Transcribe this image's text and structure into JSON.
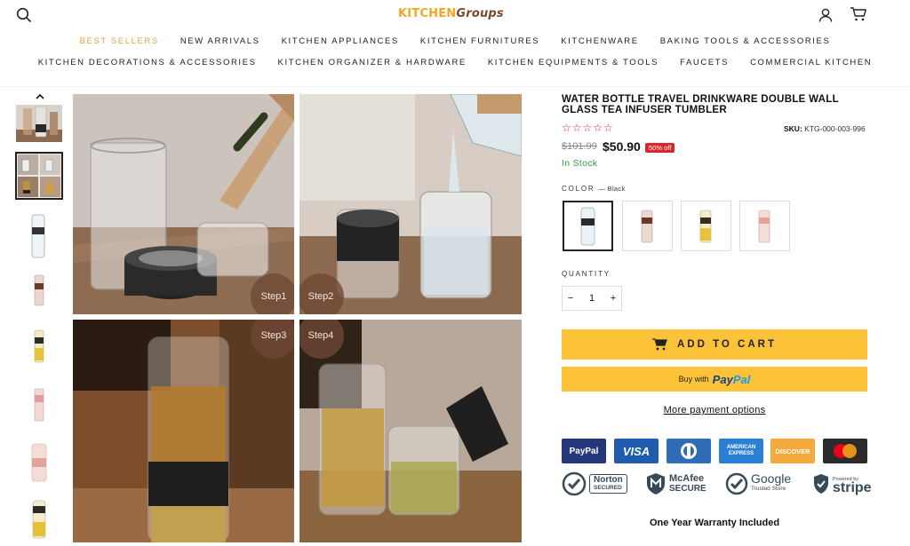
{
  "header": {
    "logo_part1": "KITCHEN",
    "logo_part2": "Groups",
    "icons": [
      "search-icon",
      "account-icon",
      "cart-icon"
    ]
  },
  "nav": {
    "row1": [
      "BEST SELLERS",
      "NEW ARRIVALS",
      "KITCHEN APPLIANCES",
      "KITCHEN FURNITURES",
      "KITCHENWARE",
      "BAKING TOOLS & ACCESSORIES"
    ],
    "row2": [
      "KITCHEN DECORATIONS & ACCESSORIES",
      "KITCHEN ORGANIZER & HARDWARE",
      "KITCHEN EQUIPMENTS & TOOLS",
      "FAUCETS",
      "COMMERCIAL KITCHEN"
    ],
    "active_color": "#e0a43c"
  },
  "gallery": {
    "steps": [
      "Step1",
      "Step2",
      "Step3",
      "Step4"
    ],
    "selected_thumb_index": 1
  },
  "product": {
    "title": "WATER BOTTLE TRAVEL DRINKWARE DOUBLE WALL GLASS TEA INFUSER TUMBLER",
    "rating_stars": "☆☆☆☆☆",
    "sku_label": "SKU:",
    "sku_value": "KTG-000-003-996",
    "old_price": "$101.99",
    "new_price": "$50.90",
    "discount": "50% off",
    "stock": "In Stock",
    "color_label": "COLOR",
    "color_value": "— Black",
    "quantity_label": "QUANTITY",
    "quantity_minus": "−",
    "quantity_value": "1",
    "quantity_plus": "+",
    "add_to_cart": "ADD TO CART",
    "buy_with": "Buy with",
    "paypal_text_1": "Pay",
    "paypal_text_2": "Pal",
    "more_payment": "More payment options",
    "warranty": "One Year Warranty Included"
  },
  "payment_cards": [
    {
      "label": "PayPal",
      "color": "#25397a"
    },
    {
      "label": "VISA",
      "color": "#1f5cae"
    },
    {
      "label": "D",
      "color": "#2f6db8"
    },
    {
      "label": "AMERICAN EXPRESS",
      "color": "#2b7fd4"
    },
    {
      "label": "DISCOVER",
      "color": "#f4a93e"
    },
    {
      "label": "mastercard",
      "color": "#2b2b2b"
    }
  ],
  "trust_badges": [
    {
      "line1": "Norton",
      "line2": "SECURED"
    },
    {
      "line1": "McAfee",
      "line2": "SECURE"
    },
    {
      "line1": "Google",
      "line2": "Trusted Store"
    },
    {
      "line1": "stripe",
      "line2": "Powered by"
    }
  ],
  "colors": {
    "accent_button": "#fcc339",
    "sale_red": "#d9262f",
    "stock_green": "#3a9a3a"
  }
}
